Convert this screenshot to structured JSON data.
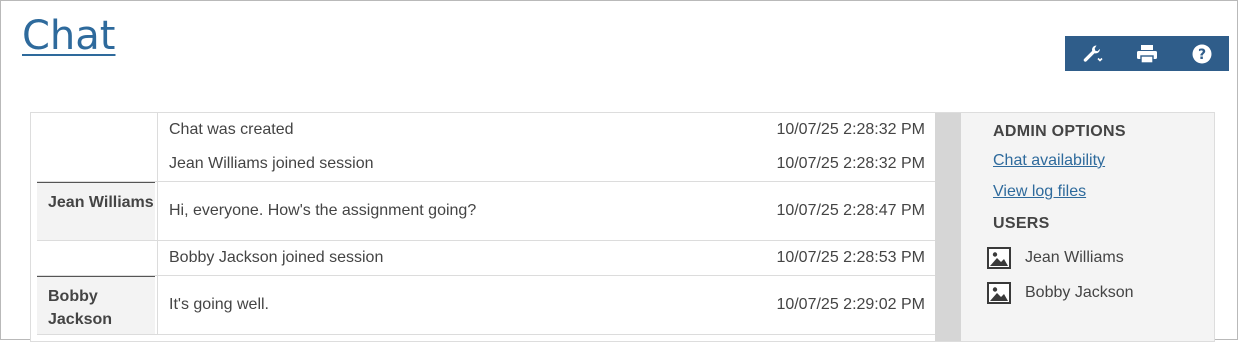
{
  "page": {
    "title": "Chat"
  },
  "toolbar": {
    "icons": [
      "wrench-icon",
      "printer-icon",
      "help-icon"
    ],
    "bg_color": "#2f5d8a"
  },
  "messages": [
    {
      "sender": "",
      "lines": [
        {
          "text": "Chat was created",
          "time": "10/07/25 2:28:32 PM"
        },
        {
          "text": "Jean Williams joined session",
          "time": "10/07/25 2:28:32 PM"
        }
      ]
    },
    {
      "sender": "Jean Williams",
      "lines": [
        {
          "text": "Hi, everyone. How's the assignment going?",
          "time": "10/07/25 2:28:47 PM"
        }
      ]
    },
    {
      "sender": "",
      "lines": [
        {
          "text": "Bobby Jackson joined session",
          "time": "10/07/25 2:28:53 PM"
        }
      ]
    },
    {
      "sender": "Bobby Jackson",
      "lines": [
        {
          "text": "It's going well.",
          "time": "10/07/25 2:29:02 PM"
        }
      ]
    }
  ],
  "sidebar": {
    "admin_heading": "ADMIN OPTIONS",
    "links": [
      "Chat availability",
      "View log files"
    ],
    "users_heading": "USERS",
    "users": [
      "Jean Williams",
      "Bobby Jackson"
    ]
  },
  "colors": {
    "link": "#2e6a9c",
    "sidebar_bg": "#f4f4f4"
  }
}
